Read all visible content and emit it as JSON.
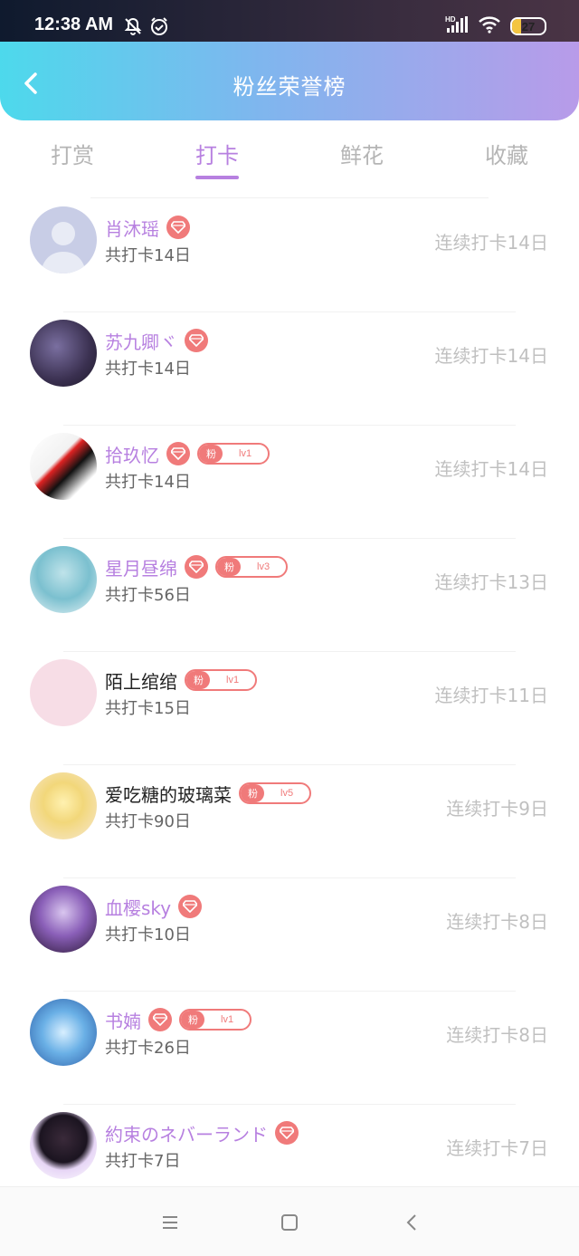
{
  "status_bar": {
    "time": "12:38 AM",
    "battery": "27",
    "battery_level_percent": 27,
    "icons": [
      "bell-off-icon",
      "alarm-icon",
      "hd-signal-icon",
      "wifi-icon",
      "battery-icon"
    ]
  },
  "header": {
    "title": "粉丝荣誉榜",
    "back_icon": "chevron-left-icon"
  },
  "tabs": [
    {
      "label": "打赏",
      "active": false
    },
    {
      "label": "打卡",
      "active": true
    },
    {
      "label": "鲜花",
      "active": false
    },
    {
      "label": "收藏",
      "active": false
    }
  ],
  "colors": {
    "accent_purple": "#b780e0",
    "badge_red": "#f07a7a",
    "header_gradient_start": "#4dd9ec",
    "header_gradient_end": "#b89be9"
  },
  "fans": [
    {
      "name": "肖沐瑶",
      "total": "共打卡14日",
      "streak": "连续打卡14日",
      "diamond": true,
      "fan_level": null,
      "name_colored": true
    },
    {
      "name": "苏九卿ヾ",
      "total": "共打卡14日",
      "streak": "连续打卡14日",
      "diamond": true,
      "fan_level": null,
      "name_colored": true
    },
    {
      "name": "拾玖忆",
      "total": "共打卡14日",
      "streak": "连续打卡14日",
      "diamond": true,
      "fan_level": "lv1",
      "name_colored": true
    },
    {
      "name": "星月昼绵",
      "total": "共打卡56日",
      "streak": "连续打卡13日",
      "diamond": true,
      "fan_level": "lv3",
      "name_colored": true
    },
    {
      "name": "陌上绾绾",
      "total": "共打卡15日",
      "streak": "连续打卡11日",
      "diamond": false,
      "fan_level": "lv1",
      "name_colored": false
    },
    {
      "name": "爱吃糖的玻璃菜",
      "total": "共打卡90日",
      "streak": "连续打卡9日",
      "diamond": false,
      "fan_level": "lv5",
      "name_colored": false
    },
    {
      "name": "血樱sky",
      "total": "共打卡10日",
      "streak": "连续打卡8日",
      "diamond": true,
      "fan_level": null,
      "name_colored": true
    },
    {
      "name": "书婻",
      "total": "共打卡26日",
      "streak": "连续打卡8日",
      "diamond": true,
      "fan_level": "lv1",
      "name_colored": true
    },
    {
      "name": "約束のネバーランド",
      "total": "共打卡7日",
      "streak": "连续打卡7日",
      "diamond": true,
      "fan_level": null,
      "name_colored": true
    }
  ],
  "fan_badge_label": "粉",
  "nav": [
    "menu-icon",
    "home-square-icon",
    "back-triangle-icon"
  ]
}
